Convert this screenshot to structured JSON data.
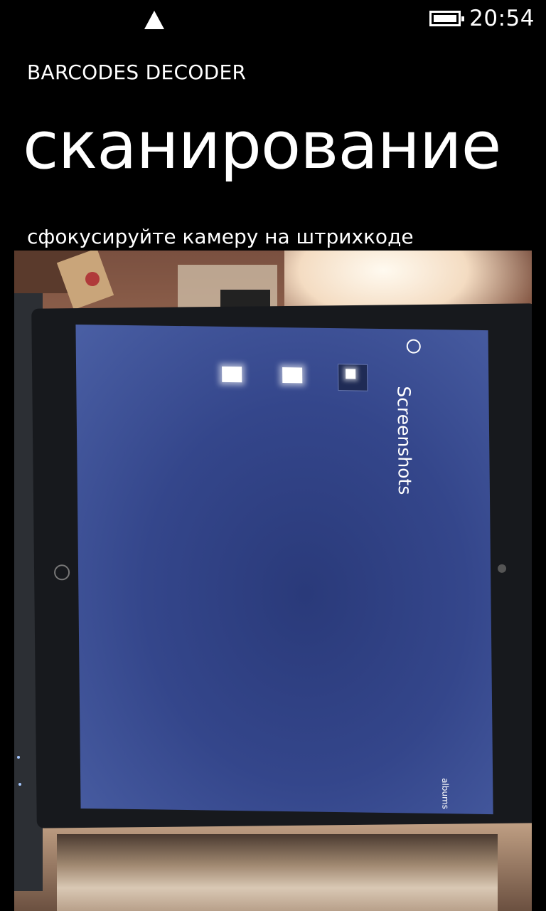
{
  "status_bar": {
    "signal_icon": "signal-triangle-icon",
    "battery_icon": "battery-icon",
    "time": "20:54"
  },
  "app": {
    "title": "BARCODES DECODER",
    "page_title": "сканирование",
    "hint": "сфокусируйте камеру на штрихкоде"
  },
  "camera_view": {
    "photo_text": {
      "screenshots": "Screenshots",
      "albums": "albums"
    }
  },
  "colors": {
    "background": "#000000",
    "foreground": "#ffffff",
    "photo_screen": "#34468b"
  }
}
